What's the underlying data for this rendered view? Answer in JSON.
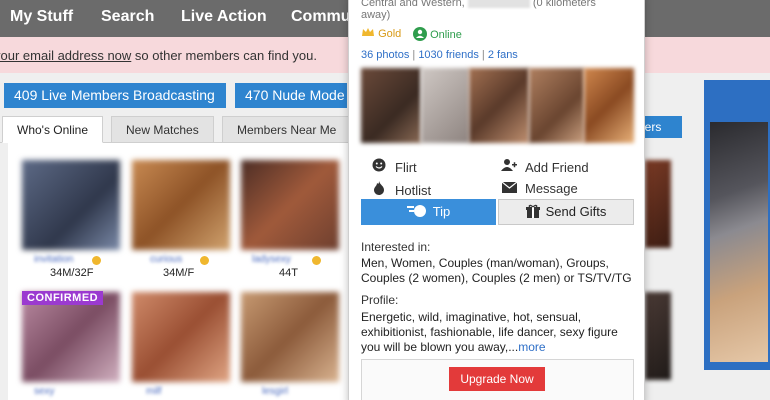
{
  "nav": {
    "items": [
      "My Stuff",
      "Search",
      "Live Action",
      "Commu"
    ]
  },
  "notice": {
    "link_text": "your email address now",
    "rest_text": " so other members can find you."
  },
  "buttons": {
    "live_members": "409 Live Members Broadcasting",
    "nude_models": "470 Nude Mode"
  },
  "tabs": [
    "Who's Online",
    "New Matches",
    "Members Near Me"
  ],
  "side_tag": "bers",
  "members": [
    {
      "username": "invitation",
      "meta": "34M/32F"
    },
    {
      "username": "curious",
      "meta": "34M/F"
    },
    {
      "username": "ladysexy",
      "meta": "44T"
    },
    {
      "username": "sexy",
      "meta": ""
    },
    {
      "username": "milf",
      "meta": ""
    },
    {
      "username": "lesgirl",
      "meta": ""
    }
  ],
  "confirmed_label": "CONFIRMED",
  "popup": {
    "location_line1": "Central and Western,",
    "location_distance": "(0 kilometers",
    "location_line2": "away)",
    "gold_label": "Gold",
    "online_label": "Online",
    "photos": "36 photos",
    "friends": "1030 friends",
    "fans": "2 fans",
    "actions": {
      "flirt": "Flirt",
      "add_friend": "Add Friend",
      "hotlist": "Hotlist",
      "message": "Message"
    },
    "tip_label": "Tip",
    "gifts_label": "Send Gifts",
    "interested_label": "Interested in:",
    "interested_text": "Men, Women, Couples (man/woman), Groups, Couples (2 women), Couples (2 men) or TS/TV/TG",
    "profile_label": "Profile:",
    "profile_text": "Energetic, wild, imaginative, hot, sensual, exhibitionist, fashionable, life dancer, sexy figure you will be blown you away,...",
    "more_label": "more",
    "upgrade_label": "Upgrade Now"
  },
  "icons": {
    "flirt": "smiley-icon",
    "add_friend": "add-user-icon",
    "hotlist": "flame-icon",
    "message": "envelope-icon",
    "tip": "coins-icon",
    "gift": "gift-icon",
    "gold": "crown-icon",
    "online": "user-online-icon"
  },
  "colors": {
    "nav_bg": "#6b6b6b",
    "accent_blue": "#2e84cf",
    "upgrade_red": "#e33a3a",
    "online_green": "#2f9d4d",
    "gold": "#d89a15",
    "confirmed_purple": "#9b3ad0"
  }
}
